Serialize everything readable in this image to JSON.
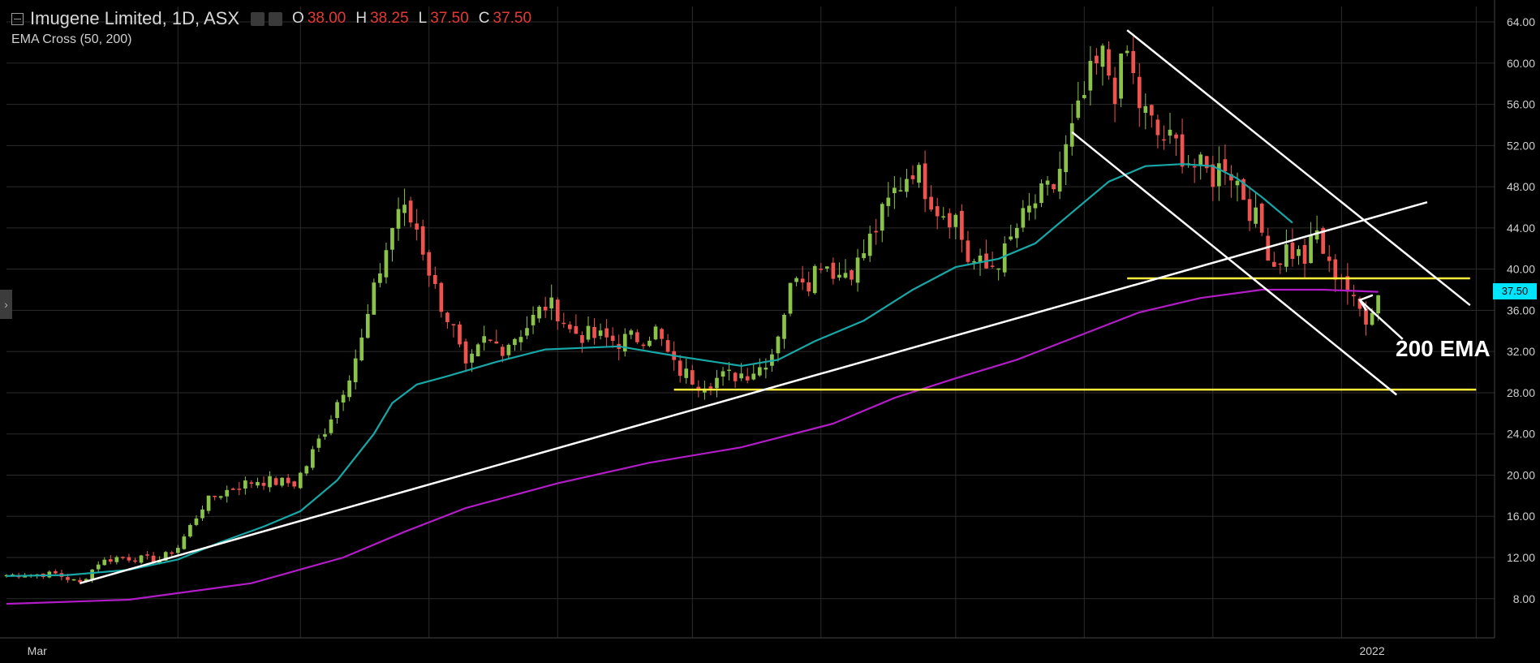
{
  "legend": {
    "title": "Imugene Limited, 1D, ASX",
    "open_label": "O",
    "open": "38.00",
    "high_label": "H",
    "high": "38.25",
    "low_label": "L",
    "low": "37.50",
    "close_label": "C",
    "close": "37.50",
    "indicator": "EMA Cross (50, 200)"
  },
  "last_price_tag": "37.50",
  "annotation": "200 EMA",
  "colors": {
    "background": "#000000",
    "grid": "#2b2b2b",
    "up_candle": "#8bc34a",
    "down_candle": "#ef5350",
    "ema50": "#17a7a7",
    "ema200": "#b21cc7",
    "support": "#ffeb3b",
    "trend": "#ffffff",
    "price_tag": "#00e5ff",
    "ohlc_values": "#e53935"
  },
  "chart_data": {
    "type": "candlestick",
    "yaxis_side": "right",
    "yaxis_ticks": [
      "8.00",
      "12.00",
      "16.00",
      "20.00",
      "24.00",
      "28.00",
      "32.00",
      "36.00",
      "40.00",
      "44.00",
      "48.00",
      "52.00",
      "56.00",
      "60.00",
      "64.00"
    ],
    "ylim": [
      4.2,
      65.5
    ],
    "xaxis_labels": [
      "Mar",
      "2022"
    ],
    "x_index_range": [
      0,
      243
    ],
    "xaxis_label_index": [
      5,
      223
    ],
    "vertical_grid_index": [
      28,
      48,
      69,
      90,
      112,
      133,
      155,
      176,
      197,
      218,
      240
    ],
    "grid": true,
    "waypoints": [
      [
        0,
        10.3
      ],
      [
        8,
        10.4
      ],
      [
        12,
        9.5
      ],
      [
        15,
        11.5
      ],
      [
        18,
        12.0
      ],
      [
        25,
        11.8
      ],
      [
        28,
        13.0
      ],
      [
        32,
        17.0
      ],
      [
        34,
        18.0
      ],
      [
        38,
        19.0
      ],
      [
        41,
        19.5
      ],
      [
        47,
        19.2
      ],
      [
        49,
        21.0
      ],
      [
        52,
        24.5
      ],
      [
        55,
        28.5
      ],
      [
        58,
        33.0
      ],
      [
        61,
        40.0
      ],
      [
        64,
        46.0
      ],
      [
        67,
        44.0
      ],
      [
        70,
        38.0
      ],
      [
        73,
        34.0
      ],
      [
        75,
        30.0
      ],
      [
        78,
        33.0
      ],
      [
        81,
        32.5
      ],
      [
        85,
        34.5
      ],
      [
        88,
        36.5
      ],
      [
        90,
        36.0
      ],
      [
        92,
        34.0
      ],
      [
        95,
        33.5
      ],
      [
        100,
        33.0
      ],
      [
        104,
        33.5
      ],
      [
        106,
        34.0
      ],
      [
        109,
        30.5
      ],
      [
        113,
        29.0
      ],
      [
        117,
        29.5
      ],
      [
        121,
        30.0
      ],
      [
        123,
        30.5
      ],
      [
        125,
        32.0
      ],
      [
        127,
        36.0
      ],
      [
        129,
        40.0
      ],
      [
        131,
        39.0
      ],
      [
        133,
        41.0
      ],
      [
        136,
        39.5
      ],
      [
        139,
        40.5
      ],
      [
        142,
        44.0
      ],
      [
        145,
        47.5
      ],
      [
        148,
        50.0
      ],
      [
        152,
        46.0
      ],
      [
        155,
        45.0
      ],
      [
        157,
        41.0
      ],
      [
        160,
        40.0
      ],
      [
        163,
        41.5
      ],
      [
        165,
        44.0
      ],
      [
        168,
        46.5
      ],
      [
        171,
        48.0
      ],
      [
        173,
        51.5
      ],
      [
        175,
        55.0
      ],
      [
        177,
        58.5
      ],
      [
        179,
        60.5
      ],
      [
        181,
        57.5
      ],
      [
        183,
        61.0
      ],
      [
        185,
        56.0
      ],
      [
        188,
        53.0
      ],
      [
        191,
        52.0
      ],
      [
        194,
        50.0
      ],
      [
        197,
        49.0
      ],
      [
        199,
        50.5
      ],
      [
        201,
        48.5
      ],
      [
        203,
        46.0
      ],
      [
        205,
        43.5
      ],
      [
        207,
        40.5
      ],
      [
        209,
        42.0
      ],
      [
        212,
        41.0
      ],
      [
        214,
        43.5
      ],
      [
        216,
        40.0
      ],
      [
        218,
        39.5
      ],
      [
        220,
        36.5
      ],
      [
        222,
        35.5
      ],
      [
        224,
        37.5
      ]
    ],
    "ema50_points": [
      [
        0,
        10.2
      ],
      [
        10,
        10.3
      ],
      [
        20,
        10.8
      ],
      [
        28,
        11.8
      ],
      [
        35,
        13.5
      ],
      [
        42,
        15.0
      ],
      [
        48,
        16.5
      ],
      [
        54,
        19.5
      ],
      [
        60,
        24.0
      ],
      [
        63,
        27.0
      ],
      [
        67,
        28.8
      ],
      [
        72,
        29.6
      ],
      [
        80,
        31.0
      ],
      [
        88,
        32.2
      ],
      [
        100,
        32.5
      ],
      [
        110,
        31.5
      ],
      [
        120,
        30.6
      ],
      [
        126,
        31.2
      ],
      [
        132,
        33.0
      ],
      [
        140,
        35.0
      ],
      [
        148,
        38.0
      ],
      [
        155,
        40.2
      ],
      [
        162,
        41.0
      ],
      [
        168,
        42.5
      ],
      [
        174,
        45.5
      ],
      [
        180,
        48.5
      ],
      [
        186,
        50.0
      ],
      [
        192,
        50.2
      ],
      [
        197,
        50.0
      ],
      [
        201,
        48.8
      ],
      [
        205,
        47.0
      ],
      [
        210,
        44.5
      ]
    ],
    "ema200_points": [
      [
        0,
        7.5
      ],
      [
        20,
        7.9
      ],
      [
        40,
        9.5
      ],
      [
        55,
        12.0
      ],
      [
        65,
        14.5
      ],
      [
        75,
        16.8
      ],
      [
        90,
        19.2
      ],
      [
        105,
        21.2
      ],
      [
        120,
        22.7
      ],
      [
        135,
        25.0
      ],
      [
        145,
        27.5
      ],
      [
        155,
        29.4
      ],
      [
        165,
        31.2
      ],
      [
        175,
        33.5
      ],
      [
        185,
        35.8
      ],
      [
        195,
        37.2
      ],
      [
        205,
        38.0
      ],
      [
        215,
        38.0
      ],
      [
        224,
        37.8
      ]
    ],
    "support_lines": [
      {
        "x": [
          183,
          239
        ],
        "y": 39.1
      },
      {
        "x": [
          109,
          240
        ],
        "y": 28.3
      }
    ],
    "trend_lines": [
      {
        "x": [
          12,
          232
        ],
        "y": [
          9.5,
          46.5
        ]
      },
      {
        "x": [
          183,
          239
        ],
        "y": [
          63.2,
          36.5
        ]
      },
      {
        "x": [
          174,
          227
        ],
        "y": [
          53.3,
          27.8
        ]
      },
      {
        "x": [
          221,
          228
        ],
        "y": [
          37.0,
          33.2
        ]
      }
    ]
  }
}
